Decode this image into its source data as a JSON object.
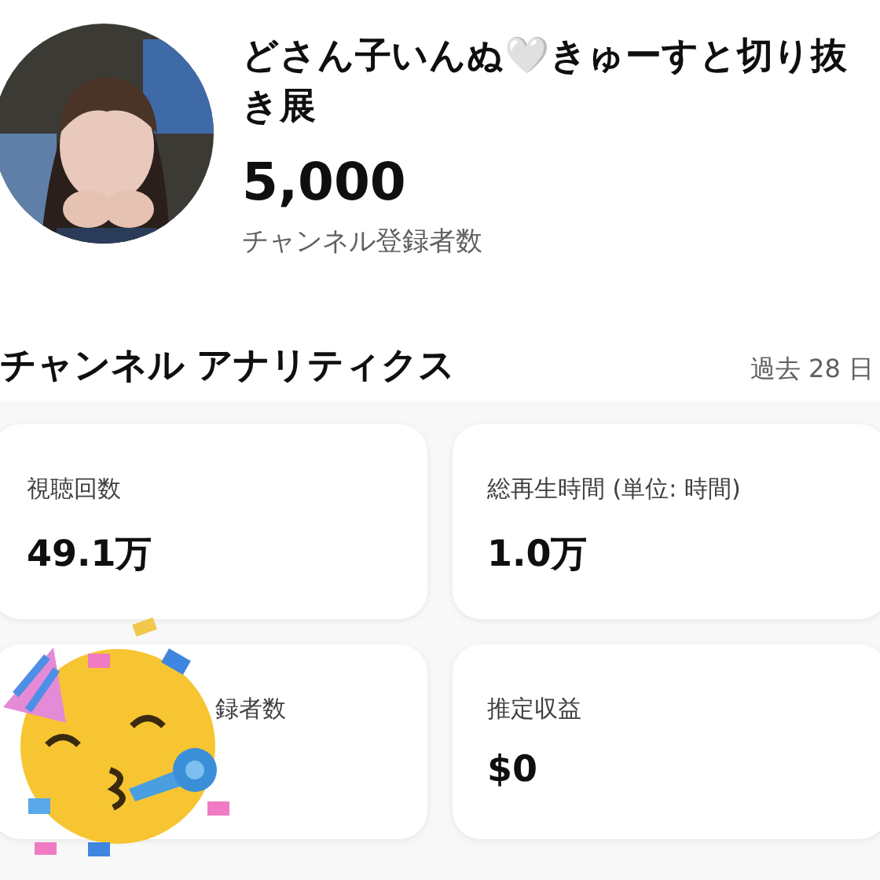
{
  "channel": {
    "name": "どさん子いんぬ🤍きゅーすと切り抜き展",
    "subscribers": "5,000",
    "subscribers_label": "チャンネル登録者数"
  },
  "analytics": {
    "title": "チャンネル アナリティクス",
    "period": "過去 28 日",
    "cards": [
      {
        "label": "視聴回数",
        "value": "49.1万"
      },
      {
        "label": "総再生時間 (単位: 時間)",
        "value": "1.0万"
      },
      {
        "label": "録者数",
        "covered": true
      },
      {
        "label": "推定収益",
        "value": "$0"
      }
    ]
  },
  "sticker": {
    "kind": "party-face"
  }
}
